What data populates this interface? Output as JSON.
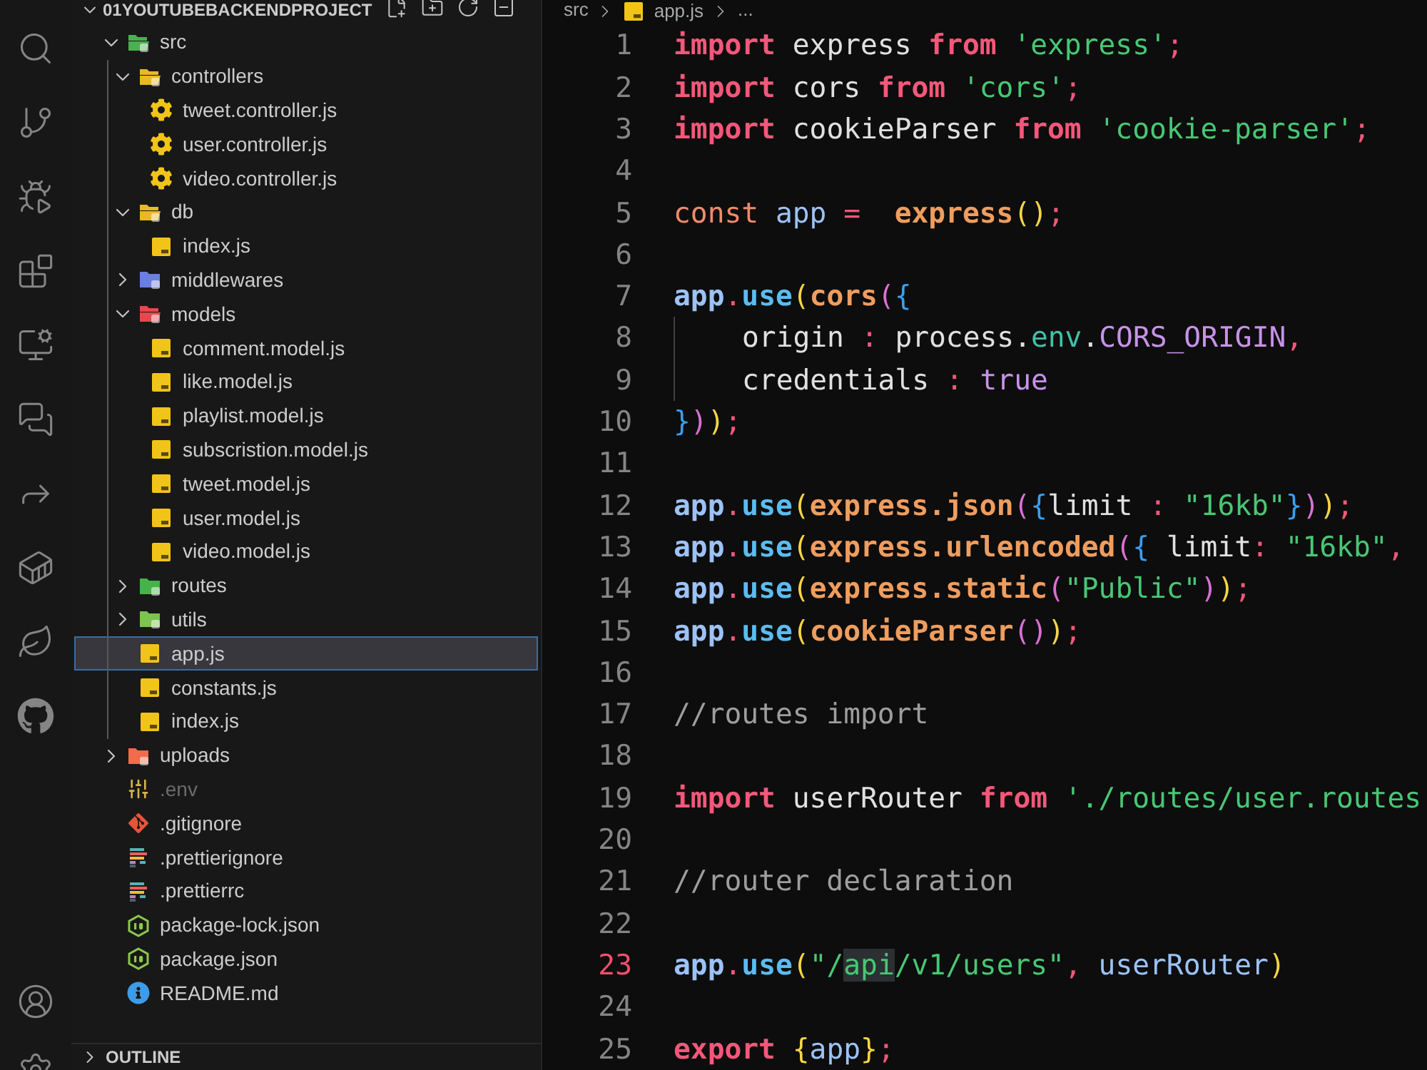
{
  "explorer": {
    "title": "01YOUTUBEBACKENDPROJECT",
    "expanded": true,
    "tree": [
      {
        "name": "src",
        "kind": "folder",
        "color": "#4caf50",
        "expanded": true,
        "selected": false,
        "dimmed": false,
        "children": [
          {
            "name": "controllers",
            "kind": "folder",
            "color": "#e8b923",
            "expanded": true,
            "selected": false,
            "dimmed": false,
            "children": [
              {
                "name": "tweet.controller.js",
                "kind": "controller",
                "selected": false,
                "dimmed": false
              },
              {
                "name": "user.controller.js",
                "kind": "controller",
                "selected": false,
                "dimmed": false
              },
              {
                "name": "video.controller.js",
                "kind": "controller",
                "selected": false,
                "dimmed": false
              }
            ]
          },
          {
            "name": "db",
            "kind": "folder",
            "color": "#e8b923",
            "expanded": true,
            "selected": false,
            "dimmed": false,
            "children": [
              {
                "name": "index.js",
                "kind": "js",
                "selected": false,
                "dimmed": false
              }
            ]
          },
          {
            "name": "middlewares",
            "kind": "folder",
            "color": "#6b7fe0",
            "expanded": false,
            "selected": false,
            "dimmed": false
          },
          {
            "name": "models",
            "kind": "folder",
            "color": "#e5484d",
            "expanded": true,
            "selected": false,
            "dimmed": false,
            "children": [
              {
                "name": "comment.model.js",
                "kind": "js",
                "selected": false,
                "dimmed": false
              },
              {
                "name": "like.model.js",
                "kind": "js",
                "selected": false,
                "dimmed": false
              },
              {
                "name": "playlist.model.js",
                "kind": "js",
                "selected": false,
                "dimmed": false
              },
              {
                "name": "subscristion.model.js",
                "kind": "js",
                "selected": false,
                "dimmed": false
              },
              {
                "name": "tweet.model.js",
                "kind": "js",
                "selected": false,
                "dimmed": false
              },
              {
                "name": "user.model.js",
                "kind": "js",
                "selected": false,
                "dimmed": false
              },
              {
                "name": "video.model.js",
                "kind": "js",
                "selected": false,
                "dimmed": false
              }
            ]
          },
          {
            "name": "routes",
            "kind": "folder",
            "color": "#45b349",
            "expanded": false,
            "selected": false,
            "dimmed": false
          },
          {
            "name": "utils",
            "kind": "folder",
            "color": "#7cc34f",
            "expanded": false,
            "selected": false,
            "dimmed": false
          },
          {
            "name": "app.js",
            "kind": "js",
            "selected": true,
            "dimmed": false
          },
          {
            "name": "constants.js",
            "kind": "js",
            "selected": false,
            "dimmed": false
          },
          {
            "name": "index.js",
            "kind": "js",
            "selected": false,
            "dimmed": false
          }
        ]
      },
      {
        "name": "uploads",
        "kind": "folder",
        "color": "#f26b4a",
        "expanded": false,
        "selected": false,
        "dimmed": false
      },
      {
        "name": ".env",
        "kind": "env",
        "selected": false,
        "dimmed": true
      },
      {
        "name": ".gitignore",
        "kind": "git",
        "selected": false,
        "dimmed": false
      },
      {
        "name": ".prettierignore",
        "kind": "prettier",
        "selected": false,
        "dimmed": false
      },
      {
        "name": ".prettierrc",
        "kind": "prettier",
        "selected": false,
        "dimmed": false
      },
      {
        "name": "package-lock.json",
        "kind": "node",
        "selected": false,
        "dimmed": false
      },
      {
        "name": "package.json",
        "kind": "node",
        "selected": false,
        "dimmed": false
      },
      {
        "name": "README.md",
        "kind": "readme",
        "selected": false,
        "dimmed": false
      }
    ]
  },
  "outline": {
    "title": "OUTLINE",
    "expanded": false
  },
  "editor": {
    "breadcrumb": [
      {
        "text": "src",
        "kind": "folder"
      },
      {
        "text": "app.js",
        "kind": "file"
      },
      {
        "text": "...",
        "kind": "more"
      }
    ],
    "lines": [
      {
        "number": "1",
        "kind": "code",
        "active": false,
        "tokens": [
          {
            "text": "import",
            "kind": "keyword"
          },
          {
            "text": " express ",
            "kind": "plain"
          },
          {
            "text": "from",
            "kind": "keyword"
          },
          {
            "text": " 'express'",
            "kind": "string"
          },
          {
            "text": ";",
            "kind": "punct"
          }
        ]
      },
      {
        "number": "2",
        "kind": "code",
        "active": false,
        "tokens": [
          {
            "text": "import",
            "kind": "keyword"
          },
          {
            "text": " cors ",
            "kind": "plain"
          },
          {
            "text": "from",
            "kind": "keyword"
          },
          {
            "text": " 'cors'",
            "kind": "string"
          },
          {
            "text": ";",
            "kind": "punct"
          }
        ]
      },
      {
        "number": "3",
        "kind": "code",
        "active": false,
        "tokens": [
          {
            "text": "import",
            "kind": "keyword"
          },
          {
            "text": " cookieParser ",
            "kind": "plain"
          },
          {
            "text": "from",
            "kind": "keyword"
          },
          {
            "text": " 'cookie-parser'",
            "kind": "string"
          },
          {
            "text": ";",
            "kind": "punct"
          }
        ]
      },
      {
        "number": "4",
        "kind": "code",
        "active": false
      },
      {
        "number": "5",
        "kind": "code",
        "active": false,
        "tokens": [
          {
            "text": "const ",
            "kind": "storage"
          },
          {
            "text": "app ",
            "kind": "variable"
          },
          {
            "text": "=  ",
            "kind": "punct"
          },
          {
            "text": "express",
            "kind": "function"
          },
          {
            "text": "()",
            "kind": "bracket1"
          },
          {
            "text": ";",
            "kind": "punct"
          }
        ]
      },
      {
        "number": "6",
        "kind": "code",
        "active": false
      },
      {
        "number": "7",
        "kind": "code",
        "active": false,
        "tokens": [
          {
            "text": "app",
            "kind": "object"
          },
          {
            "text": ".",
            "kind": "punct"
          },
          {
            "text": "use",
            "kind": "method"
          },
          {
            "text": "(",
            "kind": "bracket1"
          },
          {
            "text": "cors",
            "kind": "function"
          },
          {
            "text": "(",
            "kind": "bracket2"
          },
          {
            "text": "{",
            "kind": "bracket3"
          }
        ]
      },
      {
        "number": "8",
        "kind": "indented",
        "active": false,
        "tokens": [
          {
            "text": "origin ",
            "kind": "plain"
          },
          {
            "text": ":",
            "kind": "punct"
          },
          {
            "text": " process.",
            "kind": "plain"
          },
          {
            "text": "env",
            "kind": "property"
          },
          {
            "text": ".",
            "kind": "plain"
          },
          {
            "text": "CORS_ORIGIN",
            "kind": "constant"
          },
          {
            "text": ",",
            "kind": "punct"
          }
        ]
      },
      {
        "number": "9",
        "kind": "indented",
        "active": false,
        "tokens": [
          {
            "text": "credentials ",
            "kind": "plain"
          },
          {
            "text": ": ",
            "kind": "punct"
          },
          {
            "text": "true",
            "kind": "constant"
          }
        ]
      },
      {
        "number": "10",
        "kind": "code",
        "active": false,
        "tokens": [
          {
            "text": "}",
            "kind": "bracket3"
          },
          {
            "text": ")",
            "kind": "bracket2"
          },
          {
            "text": ")",
            "kind": "bracket1"
          },
          {
            "text": ";",
            "kind": "punct"
          }
        ]
      },
      {
        "number": "11",
        "kind": "code",
        "active": false
      },
      {
        "number": "12",
        "kind": "code",
        "active": false,
        "tokens": [
          {
            "text": "app",
            "kind": "object"
          },
          {
            "text": ".",
            "kind": "punct"
          },
          {
            "text": "use",
            "kind": "method"
          },
          {
            "text": "(",
            "kind": "bracket1"
          },
          {
            "text": "express.json",
            "kind": "function"
          },
          {
            "text": "(",
            "kind": "bracket2"
          },
          {
            "text": "{",
            "kind": "bracket3"
          },
          {
            "text": "limit ",
            "kind": "plain"
          },
          {
            "text": ": ",
            "kind": "punct"
          },
          {
            "text": "\"16kb\"",
            "kind": "string"
          },
          {
            "text": "}",
            "kind": "bracket3"
          },
          {
            "text": ")",
            "kind": "bracket2"
          },
          {
            "text": ")",
            "kind": "bracket1"
          },
          {
            "text": ";",
            "kind": "punct"
          }
        ]
      },
      {
        "number": "13",
        "kind": "code",
        "active": false,
        "tokens": [
          {
            "text": "app",
            "kind": "object"
          },
          {
            "text": ".",
            "kind": "punct"
          },
          {
            "text": "use",
            "kind": "method"
          },
          {
            "text": "(",
            "kind": "bracket1"
          },
          {
            "text": "express.urlencoded",
            "kind": "function"
          },
          {
            "text": "(",
            "kind": "bracket2"
          },
          {
            "text": "{",
            "kind": "bracket3"
          },
          {
            "text": " limit",
            "kind": "plain"
          },
          {
            "text": ": ",
            "kind": "punct"
          },
          {
            "text": "\"16kb\"",
            "kind": "string"
          },
          {
            "text": ",",
            "kind": "punct"
          }
        ]
      },
      {
        "number": "14",
        "kind": "code",
        "active": false,
        "tokens": [
          {
            "text": "app",
            "kind": "object"
          },
          {
            "text": ".",
            "kind": "punct"
          },
          {
            "text": "use",
            "kind": "method"
          },
          {
            "text": "(",
            "kind": "bracket1"
          },
          {
            "text": "express.static",
            "kind": "function"
          },
          {
            "text": "(",
            "kind": "bracket2"
          },
          {
            "text": "\"Public\"",
            "kind": "string"
          },
          {
            "text": ")",
            "kind": "bracket2"
          },
          {
            "text": ")",
            "kind": "bracket1"
          },
          {
            "text": ";",
            "kind": "punct"
          }
        ]
      },
      {
        "number": "15",
        "kind": "code",
        "active": false,
        "tokens": [
          {
            "text": "app",
            "kind": "object"
          },
          {
            "text": ".",
            "kind": "punct"
          },
          {
            "text": "use",
            "kind": "method"
          },
          {
            "text": "(",
            "kind": "bracket1"
          },
          {
            "text": "cookieParser",
            "kind": "function"
          },
          {
            "text": "()",
            "kind": "bracket2"
          },
          {
            "text": ")",
            "kind": "bracket1"
          },
          {
            "text": ";",
            "kind": "punct"
          }
        ]
      },
      {
        "number": "16",
        "kind": "code",
        "active": false
      },
      {
        "number": "17",
        "kind": "code",
        "active": false,
        "tokens": [
          {
            "text": "//routes import",
            "kind": "comment"
          }
        ]
      },
      {
        "number": "18",
        "kind": "code",
        "active": false
      },
      {
        "number": "19",
        "kind": "code",
        "active": false,
        "tokens": [
          {
            "text": "import",
            "kind": "keyword"
          },
          {
            "text": " userRouter ",
            "kind": "plain"
          },
          {
            "text": "from",
            "kind": "keyword"
          },
          {
            "text": " './routes/user.routes",
            "kind": "string"
          }
        ]
      },
      {
        "number": "20",
        "kind": "code",
        "active": false
      },
      {
        "number": "21",
        "kind": "code",
        "active": false,
        "tokens": [
          {
            "text": "//router declaration",
            "kind": "comment"
          }
        ]
      },
      {
        "number": "22",
        "kind": "code",
        "active": false
      },
      {
        "number": "23",
        "kind": "code",
        "active": true,
        "tokens": [
          {
            "text": "app",
            "kind": "object"
          },
          {
            "text": ".",
            "kind": "punct"
          },
          {
            "text": "use",
            "kind": "method"
          },
          {
            "text": "(",
            "kind": "bracket1"
          },
          {
            "text": "\"/",
            "kind": "string"
          },
          {
            "text": "api",
            "kind": "match"
          },
          {
            "text": "/v1/users\"",
            "kind": "string"
          },
          {
            "text": ", ",
            "kind": "punct"
          },
          {
            "text": "userRouter",
            "kind": "variable"
          },
          {
            "text": ")",
            "kind": "bracket1"
          }
        ]
      },
      {
        "number": "24",
        "kind": "code",
        "active": false
      },
      {
        "number": "25",
        "kind": "code",
        "active": false,
        "tokens": [
          {
            "text": "export ",
            "kind": "keyword"
          },
          {
            "text": "{",
            "kind": "bracket1"
          },
          {
            "text": "app",
            "kind": "variable"
          },
          {
            "text": "}",
            "kind": "bracket1"
          },
          {
            "text": ";",
            "kind": "punct"
          }
        ]
      }
    ]
  }
}
